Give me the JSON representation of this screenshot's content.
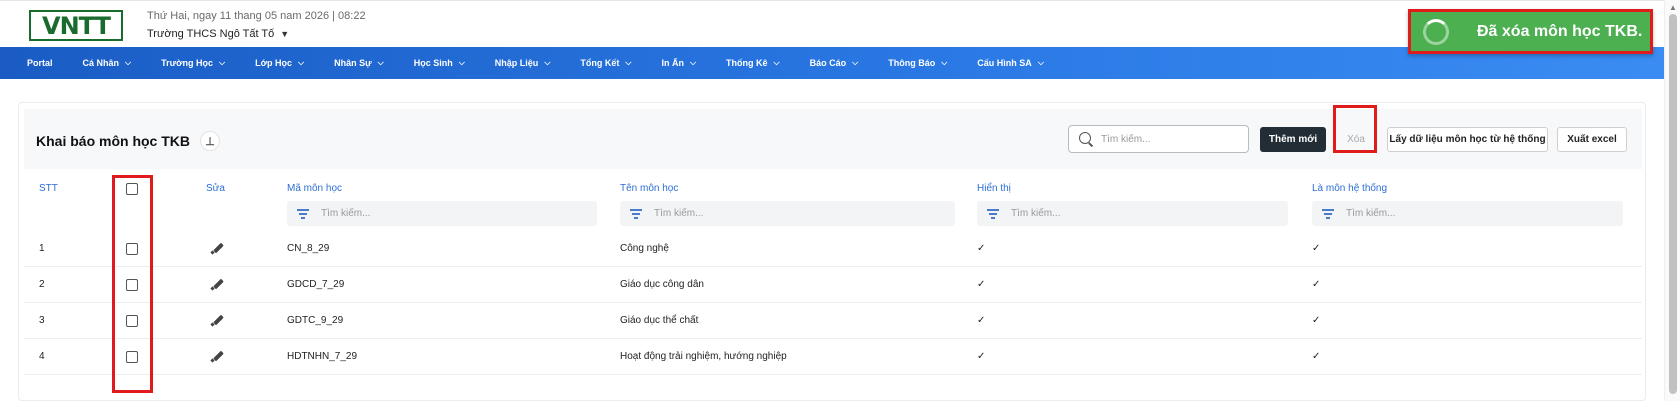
{
  "header": {
    "date_line": "Thứ Hai, ngay 11 thang 05 nam 2026 | 08:22",
    "school": "Trường THCS Ngô Tất Tố",
    "logo_text": "VNTT"
  },
  "nav": {
    "items": [
      {
        "label": "Portal",
        "has_dropdown": false
      },
      {
        "label": "Cá Nhân",
        "has_dropdown": true
      },
      {
        "label": "Trường Học",
        "has_dropdown": true
      },
      {
        "label": "Lớp Học",
        "has_dropdown": true
      },
      {
        "label": "Nhân Sự",
        "has_dropdown": true
      },
      {
        "label": "Học Sinh",
        "has_dropdown": true
      },
      {
        "label": "Nhập Liệu",
        "has_dropdown": true
      },
      {
        "label": "Tổng Kết",
        "has_dropdown": true
      },
      {
        "label": "In Ấn",
        "has_dropdown": true
      },
      {
        "label": "Thống Kê",
        "has_dropdown": true
      },
      {
        "label": "Báo Cáo",
        "has_dropdown": true
      },
      {
        "label": "Thông Báo",
        "has_dropdown": true
      },
      {
        "label": "Cấu Hình SA",
        "has_dropdown": true
      }
    ]
  },
  "toast": {
    "message": "Đã xóa môn học TKB.",
    "color": "#4caf50"
  },
  "page": {
    "title": "Khai báo môn học TKB",
    "search_placeholder": "Tìm kiếm...",
    "buttons": {
      "add": "Thêm mới",
      "delete": "Xóa",
      "fetch": "Lấy dữ liệu môn học từ hệ thống",
      "export": "Xuất excel"
    }
  },
  "table": {
    "headers": {
      "stt": "STT",
      "edit": "Sửa",
      "code": "Mã môn học",
      "name": "Tên môn học",
      "visible": "Hiển thị",
      "system": "Là môn hệ thống"
    },
    "filter_placeholder": "Tìm kiếm...",
    "rows": [
      {
        "stt": "1",
        "code": "CN_8_29",
        "name": "Công nghệ",
        "visible": "✓",
        "system": "✓",
        "checked": false
      },
      {
        "stt": "2",
        "code": "GDCD_7_29",
        "name": "Giáo dục công dân",
        "visible": "✓",
        "system": "✓",
        "checked": false
      },
      {
        "stt": "3",
        "code": "GDTC_9_29",
        "name": "Giáo dục thể chất",
        "visible": "✓",
        "system": "✓",
        "checked": false
      },
      {
        "stt": "4",
        "code": "HDTNHN_7_29",
        "name": "Hoạt động trải nghiệm, hướng nghiệp",
        "visible": "✓",
        "system": "✓",
        "checked": false
      }
    ]
  },
  "colors": {
    "accent_blue": "#2c6ed6",
    "nav_blue": "#1a5cc4",
    "highlight_red": "#e01b1b",
    "primary_dark": "#222d36"
  }
}
